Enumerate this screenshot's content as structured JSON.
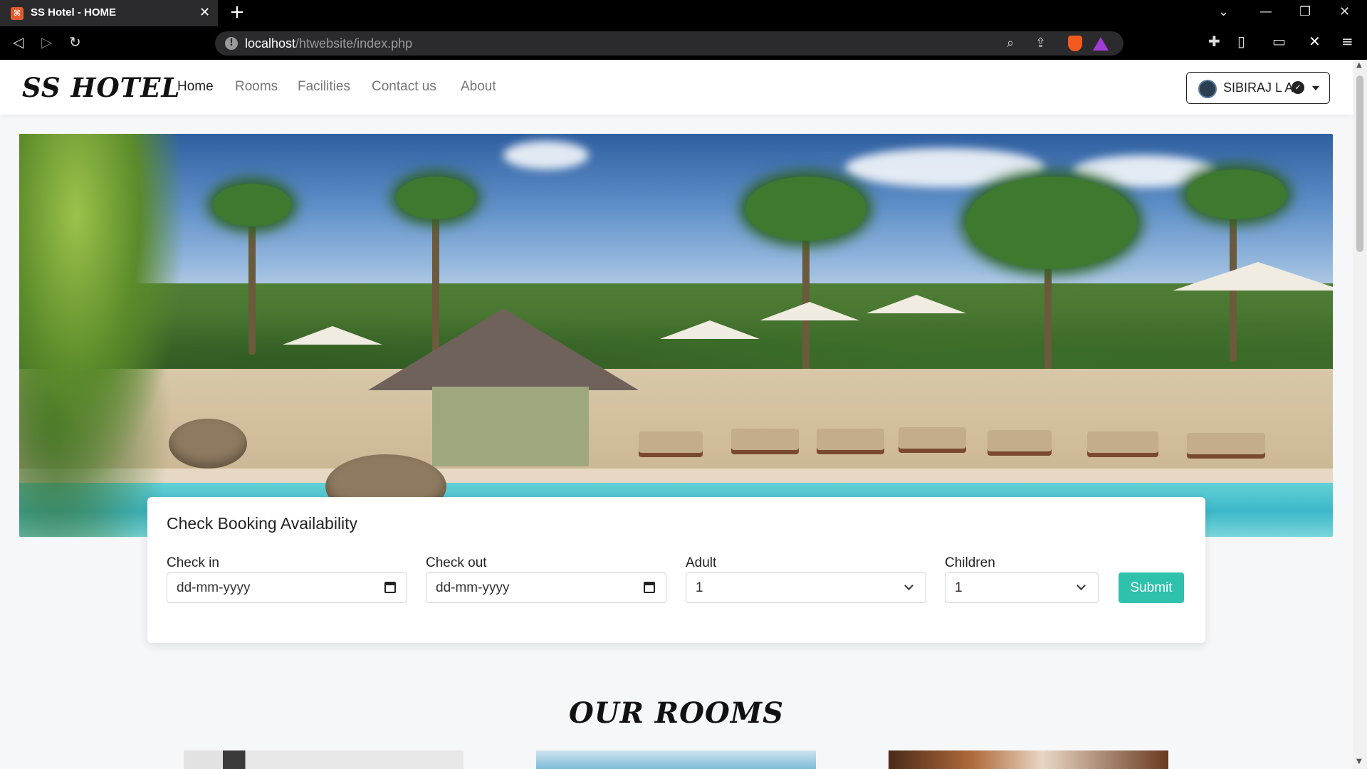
{
  "browser": {
    "tab_title": "SS Hotel - HOME",
    "favicon_text": "⌘",
    "url_host": "localhost",
    "url_path": "/htwebsite/index.php",
    "icons": [
      "back-icon",
      "forward-icon",
      "reload-icon",
      "site-info-icon",
      "zoom-icon",
      "share-icon",
      "brave-shield-icon",
      "brave-rewards-icon",
      "extensions-icon",
      "sidebar-icon",
      "wallet-icon",
      "x-extension-icon",
      "menu-icon"
    ]
  },
  "site": {
    "brand": "SS HOTEL",
    "nav": {
      "home": "Home",
      "rooms": "Rooms",
      "facilities": "Facilities",
      "contact": "Contact us",
      "about": "About"
    },
    "user": {
      "name": "SIBIRAJ L A",
      "verified_glyph": "✓"
    }
  },
  "booking": {
    "title": "Check Booking Availability",
    "check_in": {
      "label": "Check in",
      "placeholder": "dd-mm-yyyy"
    },
    "check_out": {
      "label": "Check out",
      "placeholder": "dd-mm-yyyy"
    },
    "adult": {
      "label": "Adult",
      "value": "1"
    },
    "children": {
      "label": "Children",
      "value": "1"
    },
    "submit": "Submit"
  },
  "rooms_section": {
    "title": "OUR ROOMS"
  },
  "colors": {
    "accent": "#2ec1ac",
    "page_bg": "#f6f7f9"
  }
}
